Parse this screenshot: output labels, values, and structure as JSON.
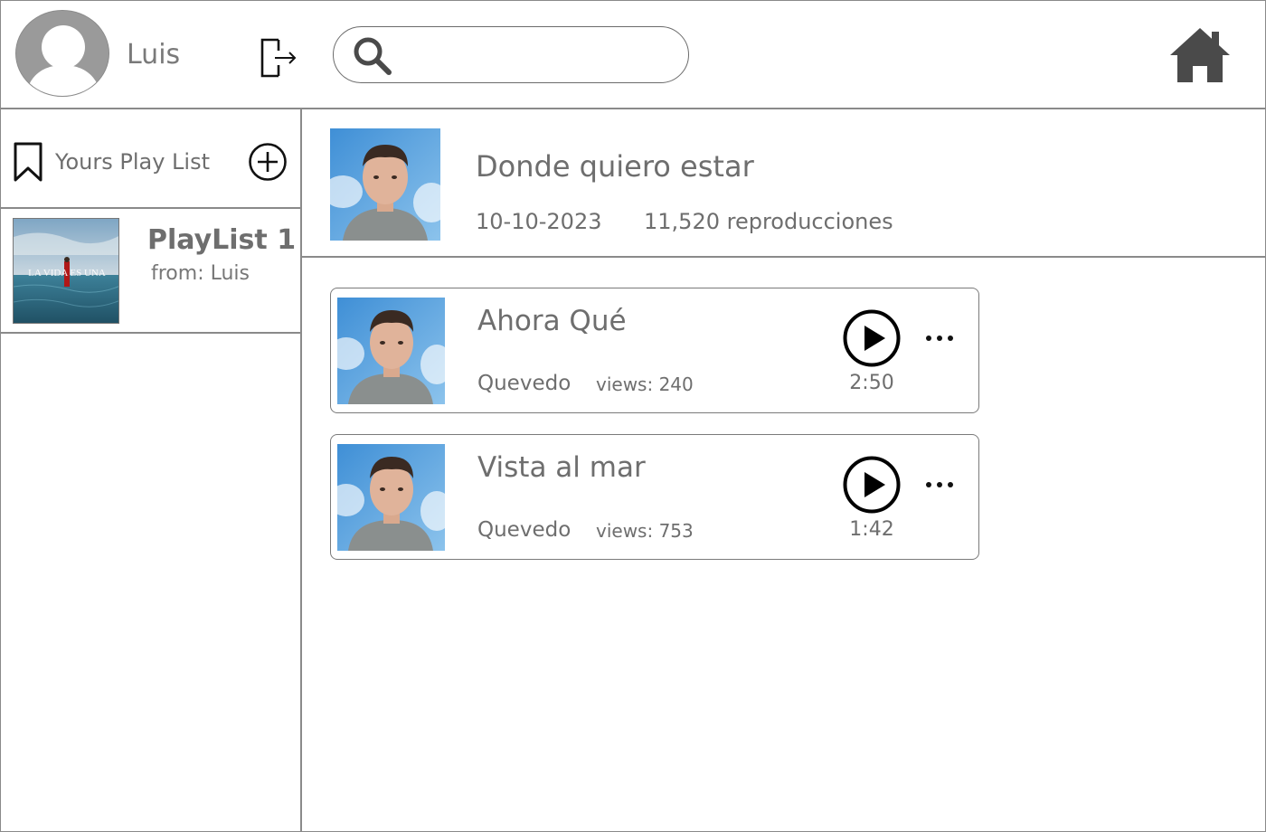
{
  "header": {
    "user_name": "Luis",
    "search": {
      "value": "",
      "placeholder": ""
    },
    "icons": {
      "avatar": "user-avatar-icon",
      "logout": "logout-icon",
      "search": "search-icon",
      "home": "home-icon"
    }
  },
  "sidebar": {
    "title": "Yours Play List",
    "icons": {
      "bookmark": "bookmark-icon",
      "add": "add-circle-icon"
    },
    "playlists": [
      {
        "name": "PlayList 1",
        "from": "from: Luis",
        "cover_text": "LA VIDA ES UNA"
      }
    ]
  },
  "album": {
    "title": "Donde quiero estar",
    "date": "10-10-2023",
    "plays": "11,520 reproducciones"
  },
  "songs": [
    {
      "title": "Ahora Qué",
      "artist": "Quevedo",
      "views": "views: 240",
      "duration": "2:50"
    },
    {
      "title": "Vista al mar",
      "artist": "Quevedo",
      "views": "views: 753",
      "duration": "1:42"
    }
  ],
  "colors": {
    "text": "#6e6e6e",
    "border": "#8a8a8a",
    "sky": "#4f9bdc",
    "sea": "#2f6f8a"
  }
}
